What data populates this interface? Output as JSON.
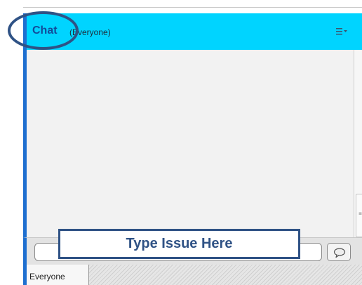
{
  "header": {
    "title": "Chat",
    "subtitle": "(Everyone)",
    "menu_icon": "menu-dropdown-icon"
  },
  "annotation": {
    "callout_text": "Type Issue Here"
  },
  "composer": {
    "send_icon": "speech-bubble-icon"
  },
  "tabs": [
    {
      "label": "Everyone",
      "selected": true
    }
  ],
  "colors": {
    "header_background": "#00d4ff",
    "accent_border": "#1e6fd0",
    "annotation": "#2f5285",
    "chat_background": "#f2f2f2"
  }
}
